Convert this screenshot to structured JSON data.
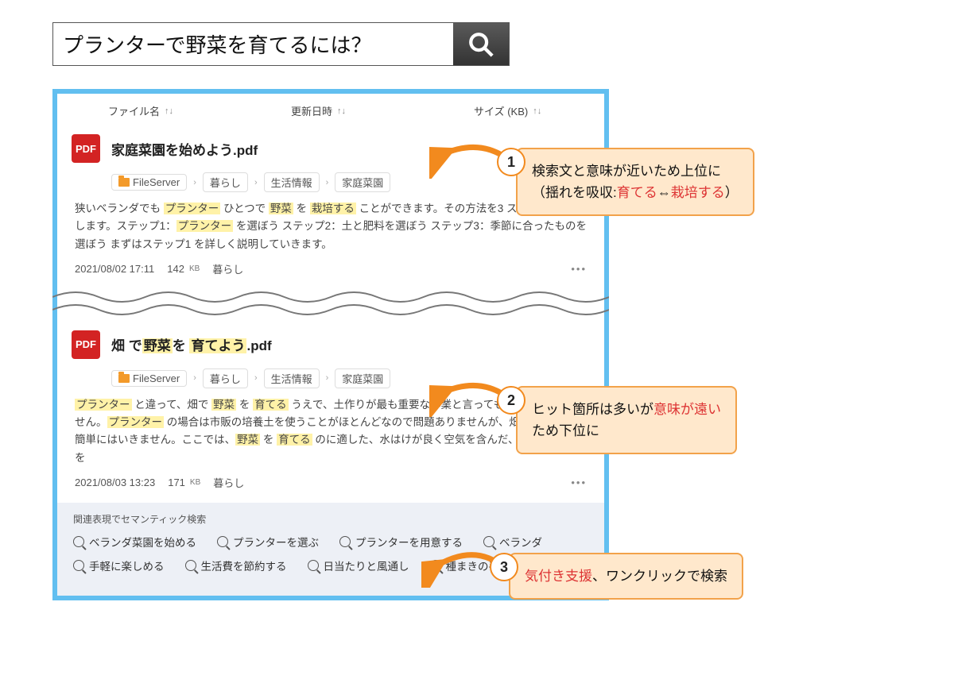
{
  "search": {
    "query": "プランターで野菜を育てるには？"
  },
  "columns": {
    "name": "ファイル名",
    "date": "更新日時",
    "size": "サイズ (KB)"
  },
  "results": {
    "0": {
      "badge": "PDF",
      "title": "家庭菜園を始めよう.pdf",
      "crumbs": {
        "0": "FileServer",
        "1": "暮らし",
        "2": "生活情報",
        "3": "家庭菜園"
      },
      "snippet_parts": {
        "0": "狭いベランダでも ",
        "h0": "プランター",
        "1": " ひとつで ",
        "h1": "野菜",
        "2": " を ",
        "h2": "栽培する",
        "3": " ことができます。その方法を3 ステップで紹介します。ステップ1：",
        "h3": "プランター",
        "4": " を選ぼう ステップ2：土と肥料を選ぼう ステップ3：季節に合ったものを選ぼう まずはステップ1 を詳しく説明していきます。"
      },
      "date": "2021/08/02  17:11",
      "size": "142",
      "sizeunit": "KB",
      "tag": "暮らし"
    },
    "1": {
      "badge": "PDF",
      "title_parts": {
        "0": "畑 で",
        "h0": "野菜",
        "1": "を ",
        "h1": "育てよう",
        "2": ".pdf"
      },
      "crumbs": {
        "0": "FileServer",
        "1": "暮らし",
        "2": "生活情報",
        "3": "家庭菜園"
      },
      "snippet_parts": {
        "h0": "プランター",
        "0": " と違って、畑で ",
        "h1": "野菜",
        "1": " を ",
        "h2": "育てる",
        "2": " うえで、土作りが最も重要な作業と言っても過言ではありません。",
        "h3": "プランター",
        "3": " の場合は市販の培養土を使うことがほとんどなので問題ありませんが、畑の場合はそう簡単にはいきません。ここでは、",
        "h4": "野菜",
        "4": " を ",
        "h5": "育てる",
        "5": " のに適した、水はけが良く空気を含んだ、ふかふかの土を"
      },
      "date": "2021/08/03  13:23",
      "size": "171",
      "sizeunit": "KB",
      "tag": "暮らし"
    }
  },
  "related": {
    "head": "関連表現でセマンティック検索",
    "row1": {
      "0": "ベランダ菜園を始める",
      "1": "プランターを選ぶ",
      "2": "プランターを用意する",
      "3": "ベランダ"
    },
    "row2": {
      "0": "手軽に楽しめる",
      "1": "生活費を節約する",
      "2": "日当たりと風通し",
      "3": "種まきの手順"
    }
  },
  "callouts": {
    "1": {
      "num": "1",
      "line1": "検索文と意味が近いため上位に",
      "line2a": "（揺れを吸収:",
      "em1": "育てる",
      "arrow": "⇔",
      "em2": "栽培する",
      "line2b": "）"
    },
    "2": {
      "num": "2",
      "line1a": "ヒット箇所は多いが",
      "em": "意味が遠い",
      "line2": "ため下位に"
    },
    "3": {
      "num": "3",
      "em": "気付き支援",
      "line": "、ワンクリックで検索"
    }
  }
}
